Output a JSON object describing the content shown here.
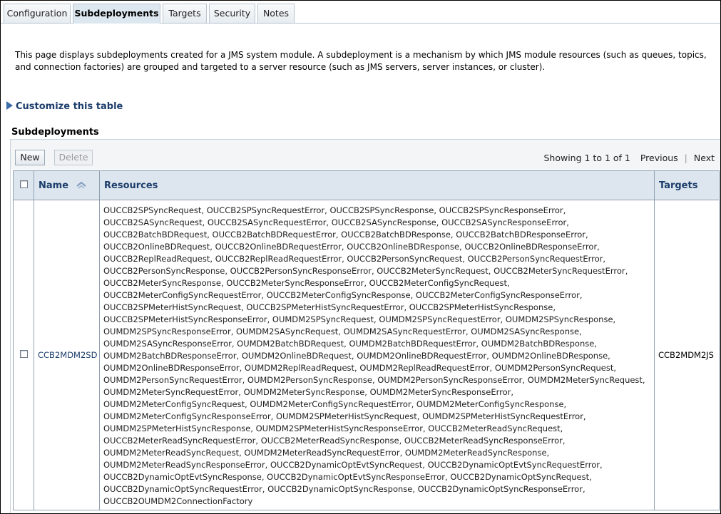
{
  "tabs": [
    {
      "label": "Configuration",
      "active": false
    },
    {
      "label": "Subdeployments",
      "active": true
    },
    {
      "label": "Targets",
      "active": false
    },
    {
      "label": "Security",
      "active": false
    },
    {
      "label": "Notes",
      "active": false
    }
  ],
  "description": "This page displays subdeployments created for a JMS system module. A subdeployment is a mechanism by which JMS module resources (such as queues, topics, and connection factories) are grouped and targeted to a server resource (such as JMS servers, server instances, or cluster).",
  "customize_label": "Customize this table",
  "section_title": "Subdeployments",
  "toolbar": {
    "new_label": "New",
    "delete_label": "Delete",
    "showing": "Showing 1 to 1 of 1",
    "previous_label": "Previous",
    "next_label": "Next"
  },
  "table": {
    "headers": {
      "name": "Name",
      "resources": "Resources",
      "targets": "Targets"
    },
    "rows": [
      {
        "name": "CCB2MDM2SD",
        "targets": "CCB2MDM2JS",
        "resource_lines": [
          "OUCCB2SPSyncRequest, OUCCB2SPSyncRequestError, OUCCB2SPSyncResponse, OUCCB2SPSyncResponseError,",
          "OUCCB2SASyncRequest, OUCCB2SASyncRequestError, OUCCB2SASyncResponse, OUCCB2SASyncResponseError,",
          "OUCCB2BatchBDRequest, OUCCB2BatchBDRequestError, OUCCB2BatchBDResponse, OUCCB2BatchBDResponseError,",
          "OUCCB2OnlineBDRequest, OUCCB2OnlineBDRequestError, OUCCB2OnlineBDResponse, OUCCB2OnlineBDResponseError,",
          "OUCCB2ReplReadRequest, OUCCB2ReplReadRequestError, OUCCB2PersonSyncRequest, OUCCB2PersonSyncRequestError,",
          "OUCCB2PersonSyncResponse, OUCCB2PersonSyncResponseError, OUCCB2MeterSyncRequest, OUCCB2MeterSyncRequestError,",
          "OUCCB2MeterSyncResponse, OUCCB2MeterSyncResponseError, OUCCB2MeterConfigSyncRequest,",
          "OUCCB2MeterConfigSyncRequestError, OUCCB2MeterConfigSyncResponse, OUCCB2MeterConfigSyncResponseError,",
          "OUCCB2SPMeterHistSyncRequest, OUCCB2SPMeterHistSyncRequestError, OUCCB2SPMeterHistSyncResponse,",
          "OUCCB2SPMeterHistSyncResponseError, OUMDM2SPSyncRequest, OUMDM2SPSyncRequestError, OUMDM2SPSyncResponse,",
          "OUMDM2SPSyncResponseError, OUMDM2SASyncRequest, OUMDM2SASyncRequestError, OUMDM2SASyncResponse,",
          "OUMDM2SASyncResponseError, OUMDM2BatchBDRequest, OUMDM2BatchBDRequestError, OUMDM2BatchBDResponse,",
          "OUMDM2BatchBDResponseError, OUMDM2OnlineBDRequest, OUMDM2OnlineBDRequestError, OUMDM2OnlineBDResponse,",
          "OUMDM2OnlineBDResponseError, OUMDM2ReplReadRequest, OUMDM2ReplReadRequestError, OUMDM2PersonSyncRequest,",
          "OUMDM2PersonSyncRequestError, OUMDM2PersonSyncResponse, OUMDM2PersonSyncResponseError, OUMDM2MeterSyncRequest,",
          "OUMDM2MeterSyncRequestError, OUMDM2MeterSyncResponse, OUMDM2MeterSyncResponseError,",
          "OUMDM2MeterConfigSyncRequest, OUMDM2MeterConfigSyncRequestError, OUMDM2MeterConfigSyncResponse,",
          "OUMDM2MeterConfigSyncResponseError, OUMDM2SPMeterHistSyncRequest, OUMDM2SPMeterHistSyncRequestError,",
          "OUMDM2SPMeterHistSyncResponse, OUMDM2SPMeterHistSyncResponseError, OUCCB2MeterReadSyncRequest,",
          "OUCCB2MeterReadSyncRequestError, OUCCB2MeterReadSyncResponse, OUCCB2MeterReadSyncResponseError,",
          "OUMDM2MeterReadSyncRequest, OUMDM2MeterReadSyncRequestError, OUMDM2MeterReadSyncResponse,",
          "OUMDM2MeterReadSyncResponseError, OUCCB2DynamicOptEvtSyncRequest, OUCCB2DynamicOptEvtSyncRequestError,",
          "OUCCB2DynamicOptEvtSyncResponse, OUCCB2DynamicOptEvtSyncResponseError, OUCCB2DynamicOptSyncRequest,",
          "OUCCB2DynamicOptSyncRequestError, OUCCB2DynamicOptSyncResponse, OUCCB2DynamicOptSyncResponseError,",
          "OUCCB2OUMDM2ConnectionFactory"
        ]
      }
    ]
  }
}
